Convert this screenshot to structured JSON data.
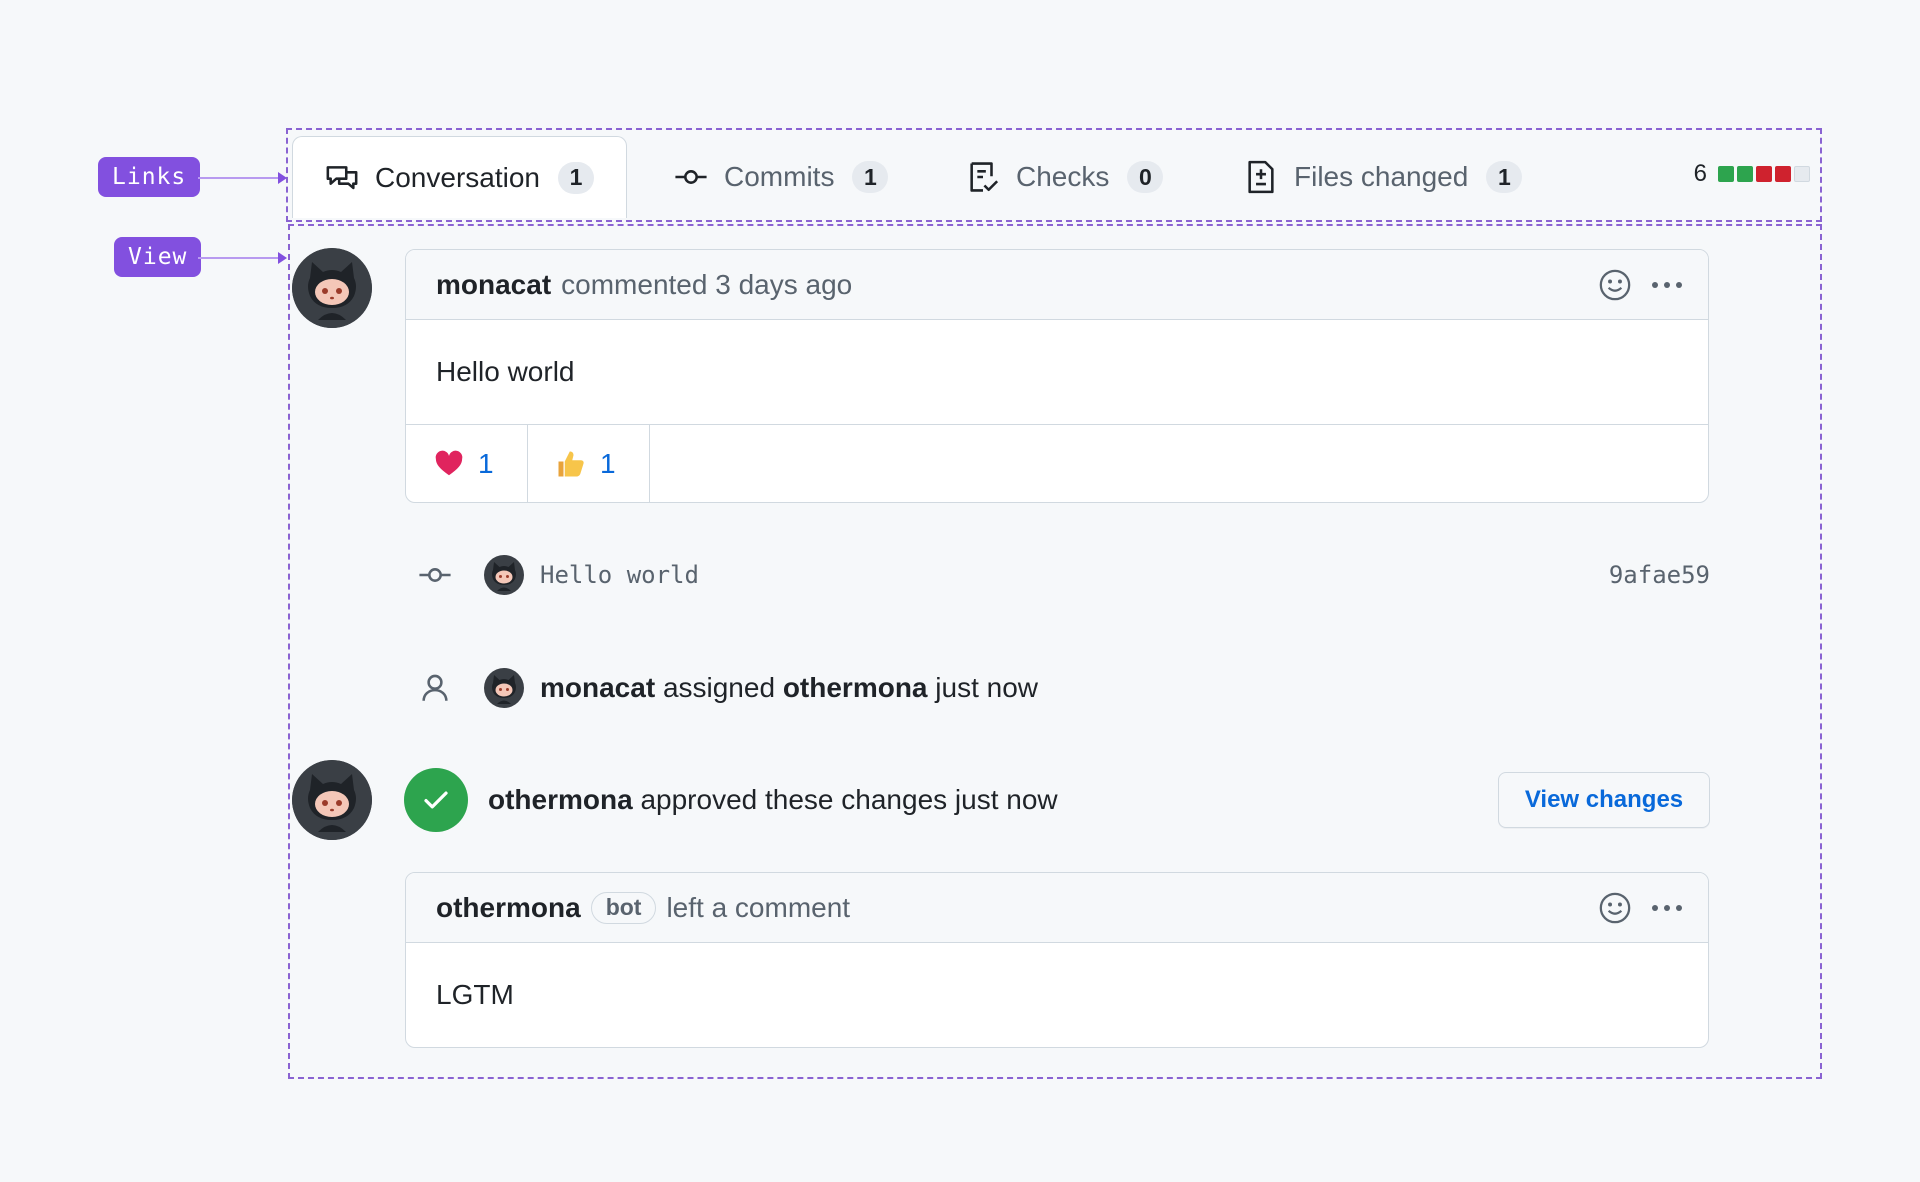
{
  "annotations": {
    "links": "Links",
    "view": "View"
  },
  "tabs": [
    {
      "label": "Conversation",
      "count": "1",
      "icon": "comment-discussion-icon"
    },
    {
      "label": "Commits",
      "count": "1",
      "icon": "git-commit-icon"
    },
    {
      "label": "Checks",
      "count": "0",
      "icon": "checklist-icon"
    },
    {
      "label": "Files changed",
      "count": "1",
      "icon": "file-diff-icon"
    }
  ],
  "diffstat": {
    "count": "6",
    "colors": [
      "#2da44e",
      "#2da44e",
      "#cf222e",
      "#cf222e",
      "#e6eaef"
    ]
  },
  "comment1": {
    "author": "monacat",
    "meta": "commented 3 days ago",
    "body": "Hello world",
    "reactions": [
      {
        "emoji": "heart",
        "count": "1"
      },
      {
        "emoji": "thumbsup",
        "count": "1"
      }
    ]
  },
  "commit": {
    "message": "Hello world",
    "sha": "9afae59"
  },
  "assign": {
    "actor": "monacat",
    "action": "assigned",
    "target": "othermona",
    "time": "just now"
  },
  "review": {
    "author": "othermona",
    "text": "approved these changes just now",
    "button": "View changes"
  },
  "comment2": {
    "author": "othermona",
    "label": "bot",
    "meta": "left a comment",
    "body": "LGTM"
  },
  "colors": {
    "accent": "#8250df",
    "link": "#0969da",
    "success": "#2da44e",
    "danger": "#cf222e"
  }
}
